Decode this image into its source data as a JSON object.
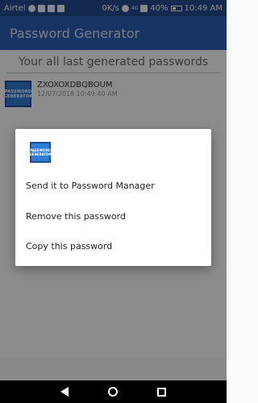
{
  "status_bar": {
    "carrier": "Airtel",
    "speed": "0K/s",
    "network": "4G",
    "battery": "40%",
    "time": "10:49 AM"
  },
  "app_bar": {
    "title": "Password Generator"
  },
  "content": {
    "subtitle": "Your all last generated passwords",
    "items": [
      {
        "password": "ZXOXOXDBQBOUM",
        "timestamp": "12/07/2018 10:49:40 AM"
      }
    ]
  },
  "logo_text": {
    "line1": "PASSWORD",
    "line2": "GENERATOR"
  },
  "dialog": {
    "options": [
      "Send it to Password Manager",
      "Remove this password",
      "Copy this password"
    ]
  },
  "colors": {
    "primary": "#2b5fb8",
    "status": "#234c8f",
    "logo": "#2e7dd6"
  },
  "icons": {
    "nav": [
      "back-icon",
      "home-icon",
      "recents-icon"
    ]
  }
}
